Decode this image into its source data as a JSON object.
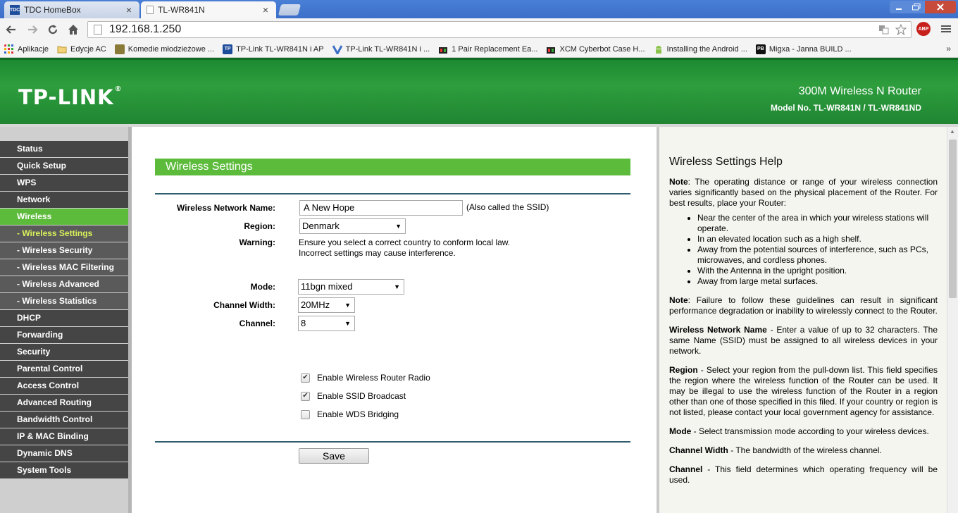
{
  "browser": {
    "tabs": [
      {
        "icon": "TDC",
        "title": "TDC HomeBox",
        "active": false
      },
      {
        "icon": "",
        "title": "TL-WR841N",
        "active": true
      }
    ],
    "close_glyph": "×",
    "url": "192.168.1.250",
    "bookmarks": [
      {
        "icon": "apps-icon",
        "label": "Aplikacje"
      },
      {
        "icon": "folder-icon",
        "label": "Edycje AC"
      },
      {
        "icon": "image-icon",
        "label": "Komedie młodzieżowe ..."
      },
      {
        "icon": "TP",
        "label": "TP-Link TL-WR841N i AP"
      },
      {
        "icon": "v-icon",
        "label": "TP-Link TL-WR841N i ..."
      },
      {
        "icon": "shop-icon",
        "label": "1 Pair Replacement Ea..."
      },
      {
        "icon": "shop-icon",
        "label": "XCM Cyberbot Case H..."
      },
      {
        "icon": "android-icon",
        "label": "Installing the Android ..."
      },
      {
        "icon": "PB",
        "label": "Migxa - Janna BUILD ..."
      }
    ],
    "more_glyph": "»",
    "abp_label": "ABP"
  },
  "header": {
    "logo": "TP-LINK",
    "logo_mark": "®",
    "product": "300M Wireless N Router",
    "model": "Model No. TL-WR841N / TL-WR841ND"
  },
  "sidebar": {
    "items": [
      {
        "label": "Status",
        "type": "main"
      },
      {
        "label": "Quick Setup",
        "type": "main"
      },
      {
        "label": "WPS",
        "type": "main"
      },
      {
        "label": "Network",
        "type": "main"
      },
      {
        "label": "Wireless",
        "type": "active"
      },
      {
        "label": "- Wireless Settings",
        "type": "sub-active"
      },
      {
        "label": "- Wireless Security",
        "type": "sub"
      },
      {
        "label": "- Wireless MAC Filtering",
        "type": "sub"
      },
      {
        "label": "- Wireless Advanced",
        "type": "sub"
      },
      {
        "label": "- Wireless Statistics",
        "type": "sub"
      },
      {
        "label": "DHCP",
        "type": "main"
      },
      {
        "label": "Forwarding",
        "type": "main"
      },
      {
        "label": "Security",
        "type": "main"
      },
      {
        "label": "Parental Control",
        "type": "main"
      },
      {
        "label": "Access Control",
        "type": "main"
      },
      {
        "label": "Advanced Routing",
        "type": "main"
      },
      {
        "label": "Bandwidth Control",
        "type": "main"
      },
      {
        "label": "IP & MAC Binding",
        "type": "main"
      },
      {
        "label": "Dynamic DNS",
        "type": "main"
      },
      {
        "label": "System Tools",
        "type": "main"
      }
    ]
  },
  "main": {
    "section_title": "Wireless Settings",
    "ssid_label": "Wireless Network Name:",
    "ssid_value": "A New Hope",
    "ssid_note": "(Also called the SSID)",
    "region_label": "Region:",
    "region_value": "Denmark",
    "warning_label": "Warning:",
    "warning_line1": "Ensure you select a correct country to conform local law.",
    "warning_line2": "Incorrect settings may cause interference.",
    "mode_label": "Mode:",
    "mode_value": "11bgn mixed",
    "width_label": "Channel Width:",
    "width_value": "20MHz",
    "channel_label": "Channel:",
    "channel_value": "8",
    "select_arrow": "▼",
    "check_glyph": "✔",
    "checkboxes": [
      {
        "label": "Enable Wireless Router Radio",
        "checked": true
      },
      {
        "label": "Enable SSID Broadcast",
        "checked": true
      },
      {
        "label": "Enable WDS Bridging",
        "checked": false
      }
    ],
    "save_label": "Save"
  },
  "help": {
    "title": "Wireless Settings Help",
    "note1_label": "Note",
    "note1_text": ": The operating distance or range of your wireless connection varies significantly based on the physical placement of the Router. For best results, place your Router:",
    "bullets": [
      "Near the center of the area in which your wireless stations will operate.",
      "In an elevated location such as a high shelf.",
      "Away from the potential sources of interference, such as PCs, microwaves, and cordless phones.",
      "With the Antenna in the upright position.",
      "Away from large metal surfaces."
    ],
    "note2_label": "Note",
    "note2_text": ": Failure to follow these guidelines can result in significant performance degradation or inability to wirelessly connect to the Router.",
    "ssid_label": "Wireless Network Name",
    "ssid_text": " - Enter a value of up to 32 characters. The same Name (SSID) must be assigned to all wireless devices in your network.",
    "region_label": "Region",
    "region_text": " - Select your region from the pull-down list. This field specifies the region where the wireless function of the Router can be used. It may be illegal to use the wireless function of the Router in a region other than one of those specified in this filed. If your country or region is not listed, please contact your local government agency for assistance.",
    "mode_label": "Mode",
    "mode_text": " - Select transmission mode according to your wireless devices.",
    "width_label": "Channel Width",
    "width_text": " - The bandwidth of the wireless channel.",
    "channel_label": "Channel",
    "channel_text": " - This field determines which operating frequency will be used."
  }
}
